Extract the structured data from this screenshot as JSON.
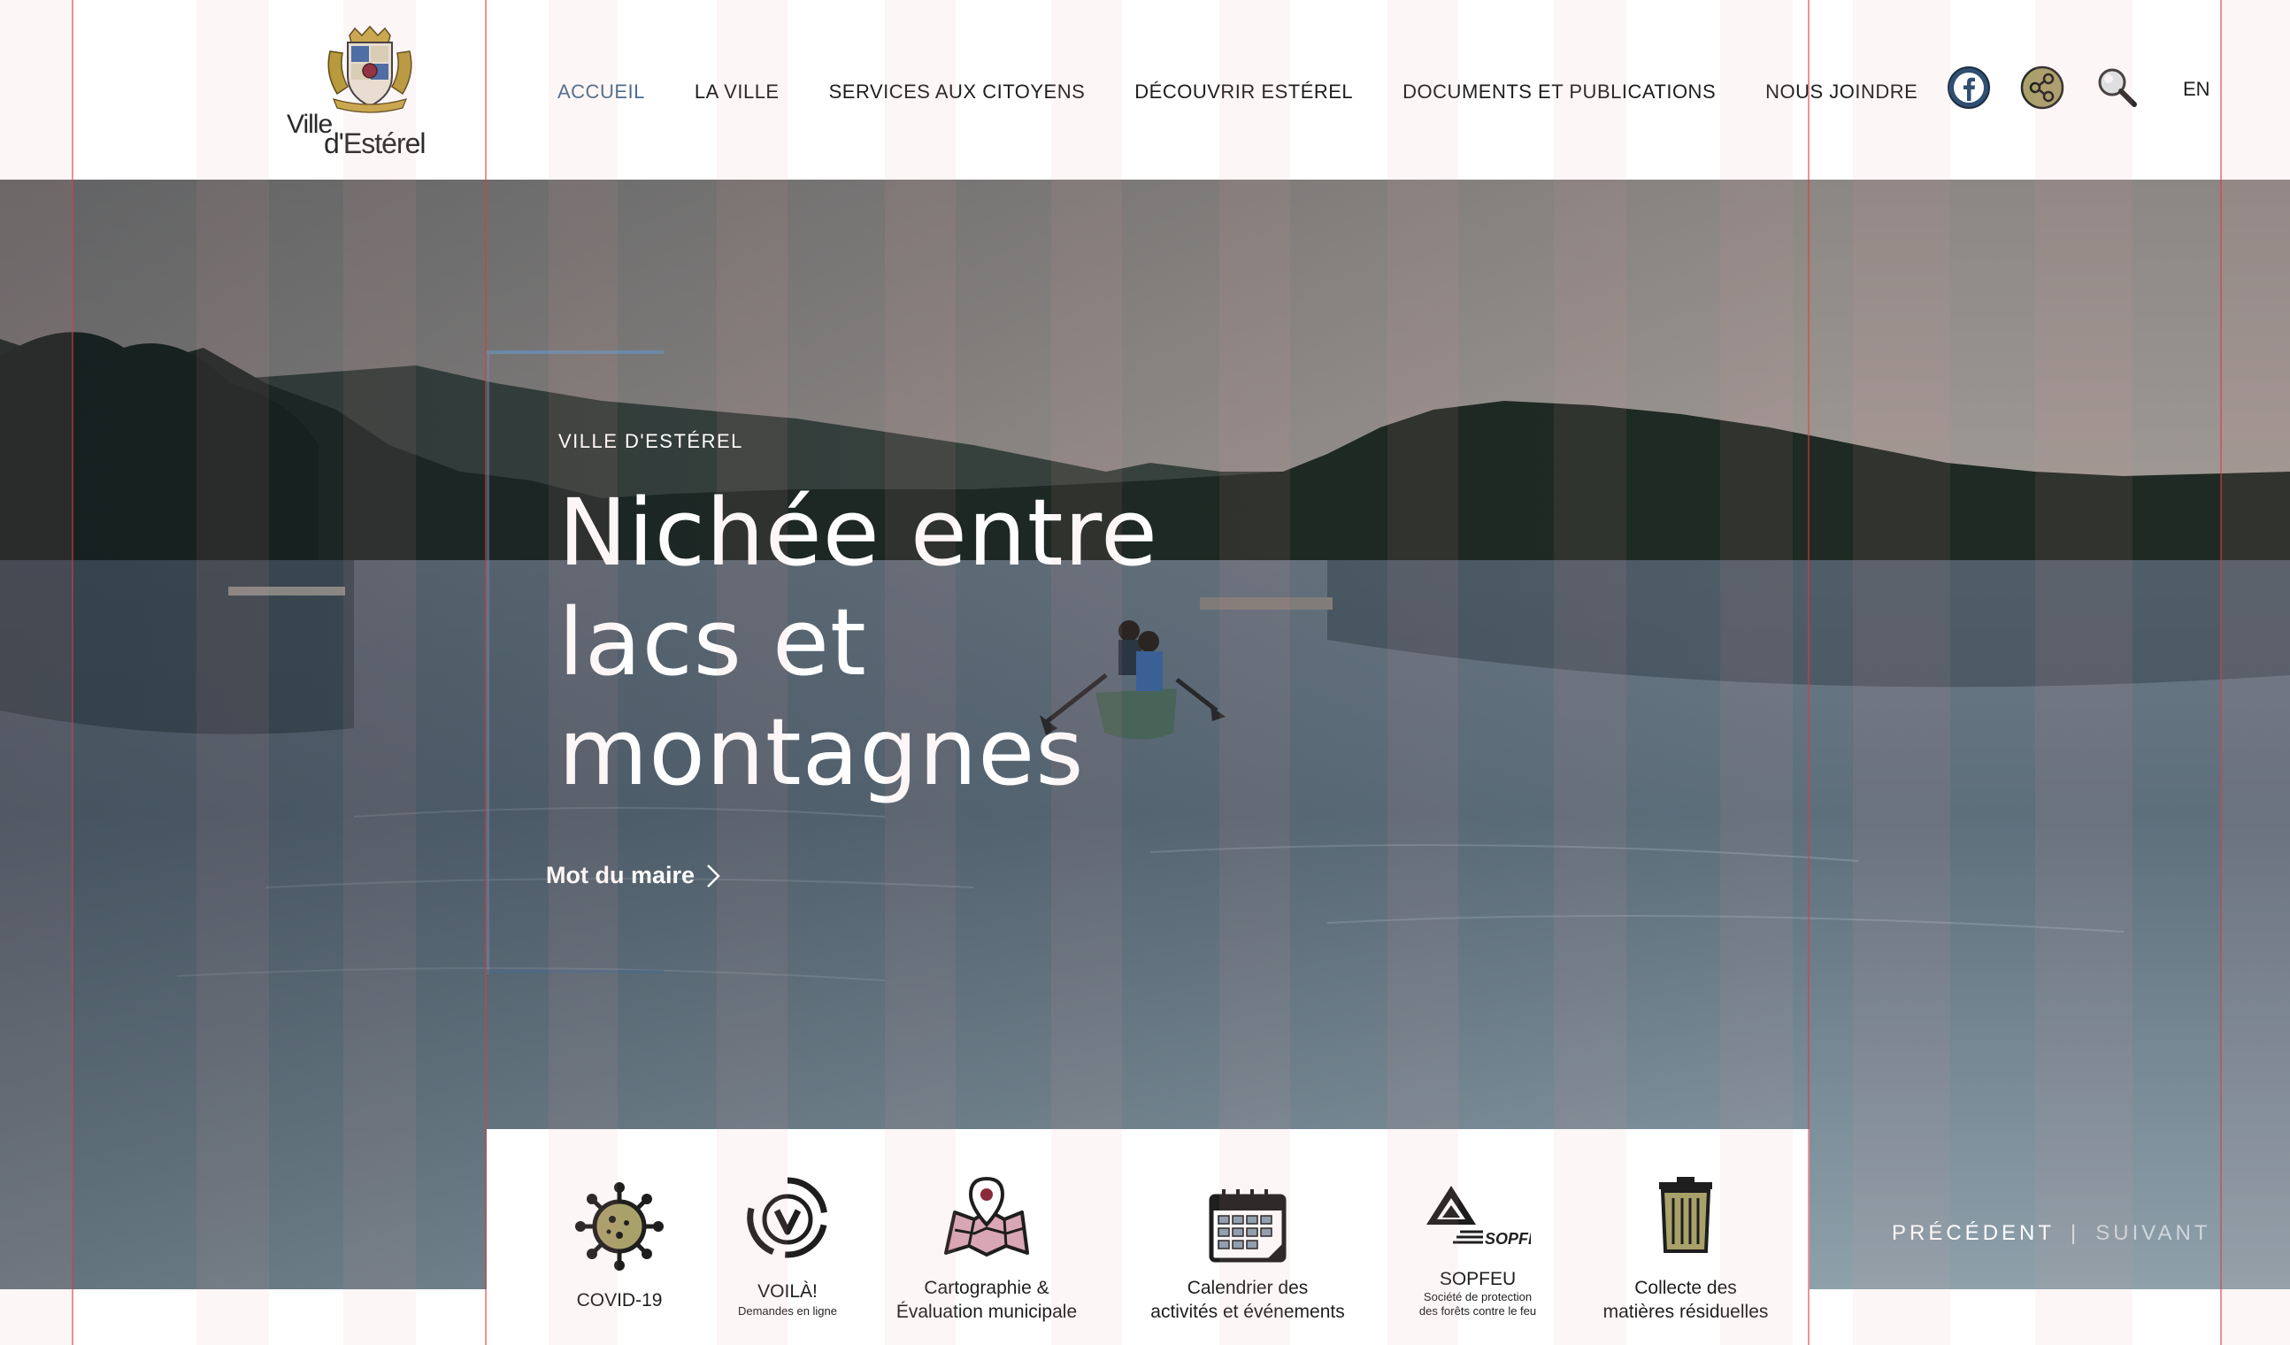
{
  "brand": {
    "logo_line1": "Ville",
    "logo_line2": "d'Estérel"
  },
  "nav": {
    "items": [
      {
        "label": "ACCUEIL",
        "active": true
      },
      {
        "label": "LA VILLE"
      },
      {
        "label": "SERVICES AUX CITOYENS"
      },
      {
        "label": "DÉCOUVRIR ESTÉREL"
      },
      {
        "label": "DOCUMENTS ET PUBLICATIONS"
      },
      {
        "label": "NOUS JOINDRE"
      }
    ],
    "active_color": "#4a6d8c"
  },
  "tools": {
    "facebook_icon": "facebook-icon",
    "share_icon": "share-icon",
    "search_icon": "search-icon",
    "language": "EN"
  },
  "hero": {
    "eyebrow": "VILLE D'ESTÉREL",
    "title_line1": "Nichée entre",
    "title_line2": "lacs et",
    "title_line3": "montagnes",
    "cta_label": "Mot du maire",
    "accent_color": "#6a8aa8"
  },
  "slider": {
    "prev": "PRÉCÉDENT",
    "separator": "|",
    "next": "SUIVANT"
  },
  "quick_links": [
    {
      "label": "COVID-19",
      "icon": "virus-icon"
    },
    {
      "label": "VOILÀ!",
      "sub": "Demandes en ligne",
      "icon": "voila-icon"
    },
    {
      "label": "Cartographie &",
      "label2": "Évaluation municipale",
      "icon": "map-pin-icon"
    },
    {
      "label": "Calendrier des",
      "label2": "activités et événements",
      "icon": "calendar-icon"
    },
    {
      "label": "SOPFEU",
      "sub": "Société de protection",
      "sub2": "des forêts contre le feu",
      "icon": "sopfeu-icon",
      "logo_text": "SOPFEU"
    },
    {
      "label": "Collecte des",
      "label2": "matières résiduelles",
      "icon": "trash-icon"
    }
  ]
}
